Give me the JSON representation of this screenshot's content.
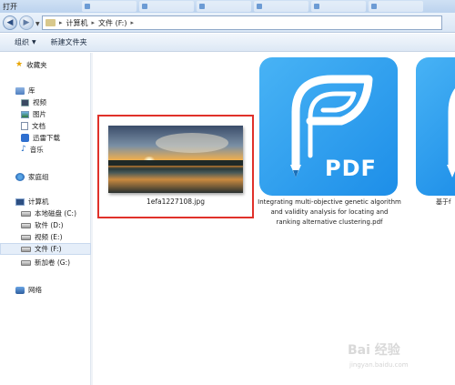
{
  "window": {
    "title": "打开"
  },
  "address": {
    "breadcrumbs": [
      "计算机",
      "文件 (F:)"
    ]
  },
  "toolbar": {
    "organize": "组织",
    "new_folder": "新建文件夹"
  },
  "sidebar": {
    "favorites": "收藏夹",
    "library": "库",
    "library_items": [
      "视频",
      "图片",
      "文档",
      "迅雷下载",
      "音乐"
    ],
    "homegroup": "家庭组",
    "computer": "计算机",
    "drives": [
      "本地磁盘 (C:)",
      "软件 (D:)",
      "视频 (E:)",
      "文件 (F:)",
      "新加卷 (G:)"
    ],
    "selected_drive": "文件 (F:)",
    "network": "网络"
  },
  "files": [
    {
      "name": "1efa1227108.jpg",
      "type": "image"
    },
    {
      "name": "Integrating multi-objective genetic algorithm and validity analysis for locating and ranking alternative clustering.pdf",
      "type": "pdf",
      "caption_lines": [
        "Integrating multi-objective genetic algorithm",
        "and validity analysis for locating and",
        "ranking alternative clustering.pdf"
      ],
      "icon_text": "PDF"
    },
    {
      "name": "基于f",
      "type": "pdf"
    }
  ],
  "watermark": {
    "logo": "Bai 经验",
    "sub": "jingyan.baidu.com"
  },
  "colors": {
    "selection_border": "#e0312a",
    "pdf_tile": "#2a9bef"
  }
}
